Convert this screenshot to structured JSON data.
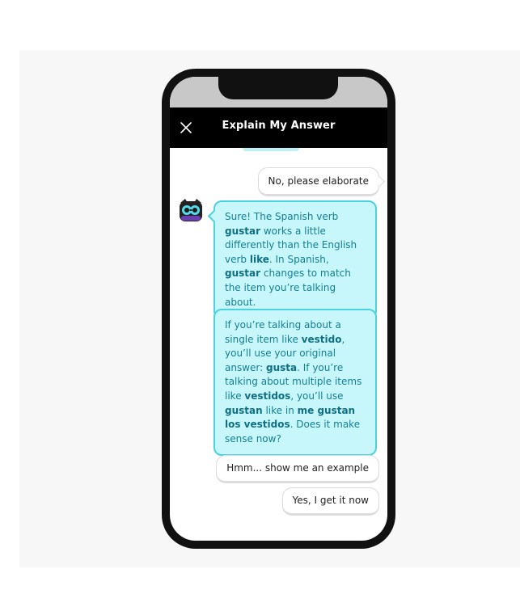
{
  "header": {
    "title": "Explain My Answer",
    "close_icon": "close-icon"
  },
  "messages": {
    "user_reply": "No, please elaborate",
    "bot_1": {
      "p1": "Sure! The Spanish verb ",
      "b1": "gustar",
      "p2": " works a little differently than the English verb ",
      "b2": "like",
      "p3": ". In Spanish, ",
      "b3": "gustar",
      "p4": " changes to match the item you’re talking about."
    },
    "bot_2": {
      "p1": "If you’re talking about a single item like ",
      "b1": "vestido",
      "p2": ", you’ll use your original answer: ",
      "b2": "gusta",
      "p3": ". If you’re talking about multiple items like ",
      "b3": "vestidos",
      "p4": ", you’ll use ",
      "b4": "gustan",
      "p5": " like in ",
      "b5": "me gustan los vestidos",
      "p6": ". Does it make sense now?"
    }
  },
  "options": {
    "example": "Hmm... show me an example",
    "got_it": "Yes, I get it now"
  },
  "colors": {
    "bot_bubble_bg": "#c7f7fa",
    "bot_bubble_border": "#49d2e0",
    "bot_text": "#137f95",
    "header_bg": "#000000"
  }
}
